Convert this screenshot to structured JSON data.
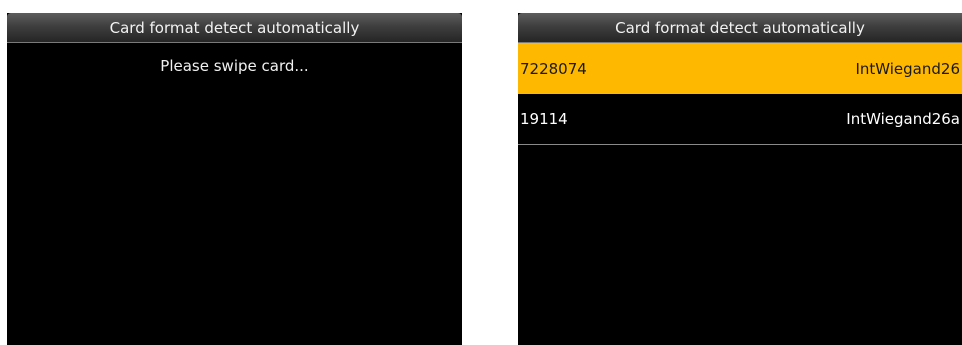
{
  "left_screen": {
    "title": "Card format detect automatically",
    "prompt": "Please swipe card..."
  },
  "right_screen": {
    "title": "Card format detect automatically",
    "rows": [
      {
        "card_number": "7228074",
        "format": "IntWiegand26",
        "selected": true
      },
      {
        "card_number": "19114",
        "format": "IntWiegand26a",
        "selected": false
      }
    ],
    "highlight_color": "#FFB800"
  }
}
